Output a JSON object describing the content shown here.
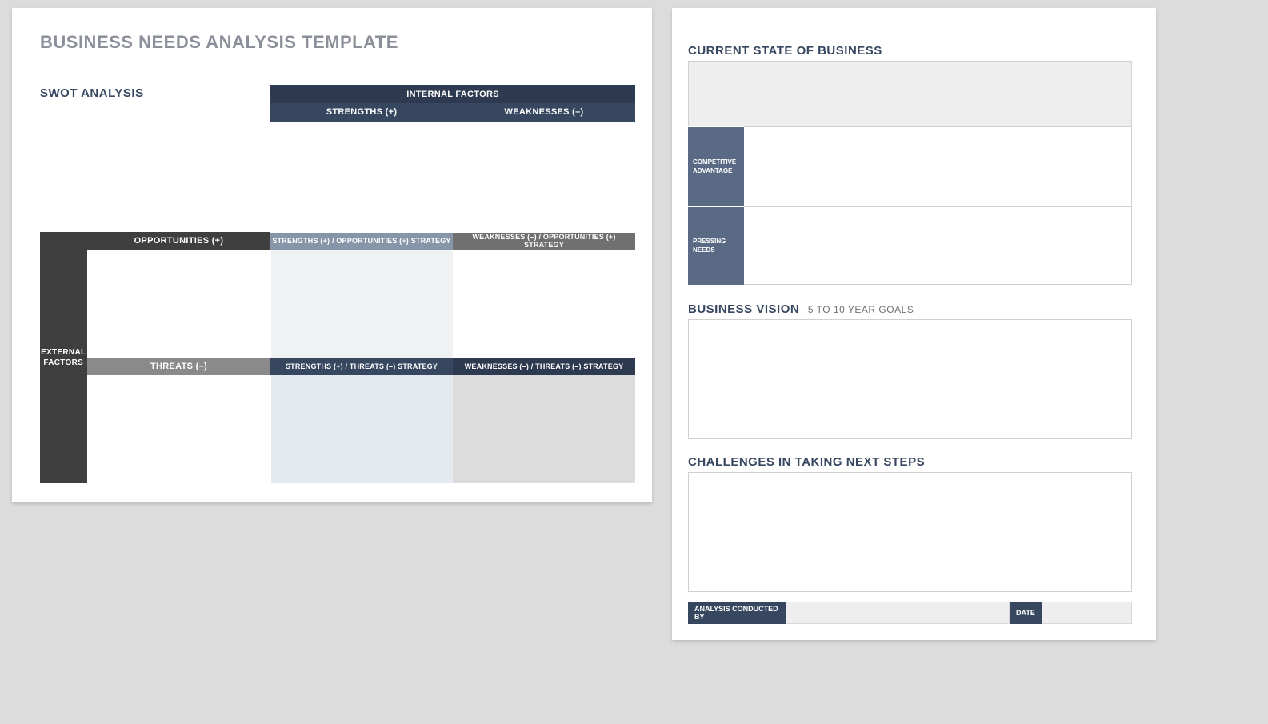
{
  "title": "BUSINESS NEEDS ANALYSIS TEMPLATE",
  "swot": {
    "label": "SWOT ANALYSIS",
    "internal": "INTERNAL   FACTORS",
    "external": "EXTERNAL FACTORS",
    "strengths": "STRENGTHS (+)",
    "weaknesses": "WEAKNESSES (–)",
    "opportunities": "OPPORTUNITIES (+)",
    "threats": "THREATS (–)",
    "so": "STRENGTHS (+) / OPPORTUNITIES (+) STRATEGY",
    "wo": "WEAKNESSES (–) / OPPORTUNITIES (+) STRATEGY",
    "st": "STRENGTHS (+) / THREATS (–) STRATEGY",
    "wt": "WEAKNESSES (–) / THREATS (–) STRATEGY"
  },
  "right": {
    "current_state": "CURRENT STATE OF BUSINESS",
    "comp_adv": "COMPETITIVE ADVANTAGE",
    "pressing": "PRESSING NEEDS",
    "vision": "BUSINESS VISION",
    "vision_sub": "5 TO 10 YEAR GOALS",
    "challenges": "CHALLENGES IN TAKING NEXT STEPS",
    "conducted_by": "ANALYSIS CONDUCTED BY",
    "date": "DATE"
  }
}
